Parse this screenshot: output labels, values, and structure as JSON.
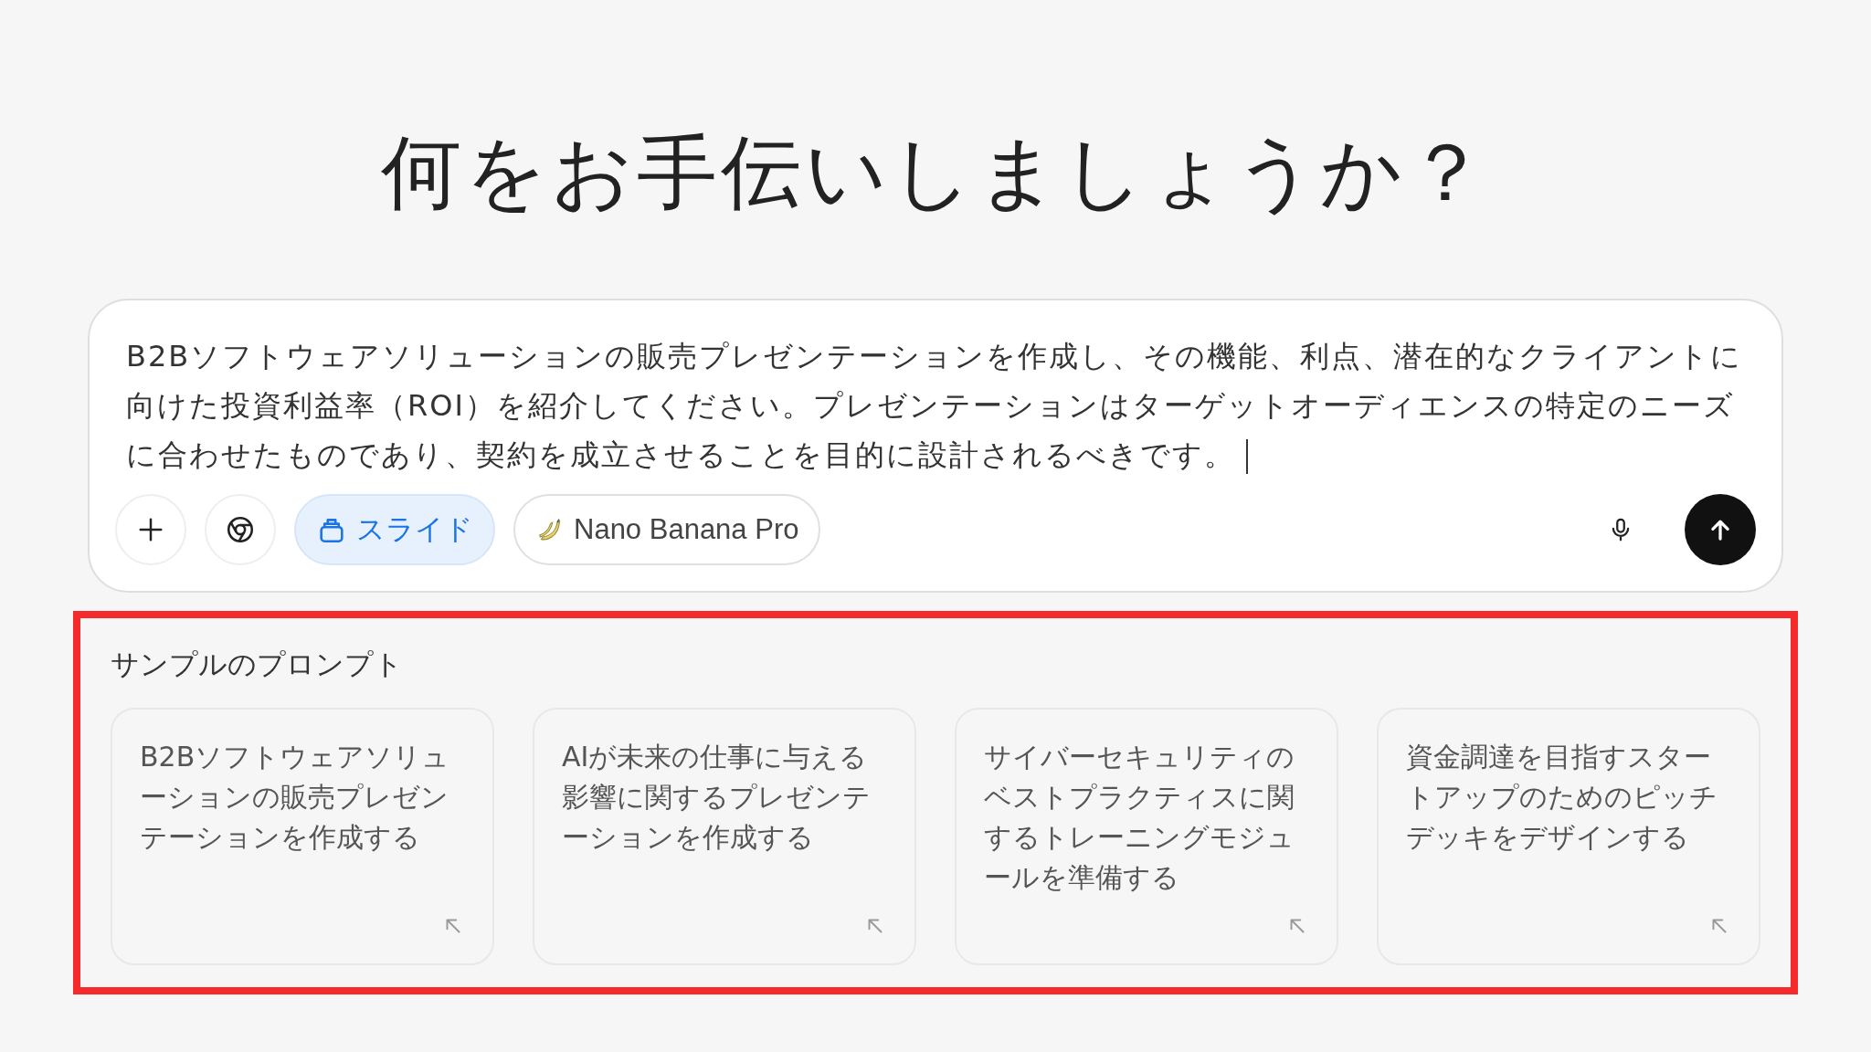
{
  "heading": "何をお手伝いしましょうか？",
  "composer": {
    "value": "B2Bソフトウェアソリューションの販売プレゼンテーションを作成し、その機能、利点、潜在的なクライアントに向けた投資利益率（ROI）を紹介してください。プレゼンテーションはターゲットオーディエンスの特定のニーズに合わせたものであり、契約を成立させることを目的に設計されるべきです。",
    "tools": [
      {
        "kind": "plus"
      },
      {
        "kind": "aperture"
      },
      {
        "kind": "slides",
        "label": "スライド",
        "selected": true
      },
      {
        "kind": "model",
        "label": "Nano Banana Pro",
        "selected": false
      }
    ]
  },
  "sample_prompts": {
    "title": "サンプルのプロンプト",
    "highlighted": true,
    "cards": [
      {
        "text": "B2Bソフトウェアソリューションの販売プレゼンテーションを作成する"
      },
      {
        "text": "AIが未来の仕事に与える影響に関するプレゼンテーションを作成する"
      },
      {
        "text": "サイバーセキュリティのベストプラクティスに関するトレーニングモジュールを準備する"
      },
      {
        "text": "資金調達を目指すスタートアップのためのピッチデッキをデザインする"
      }
    ]
  }
}
